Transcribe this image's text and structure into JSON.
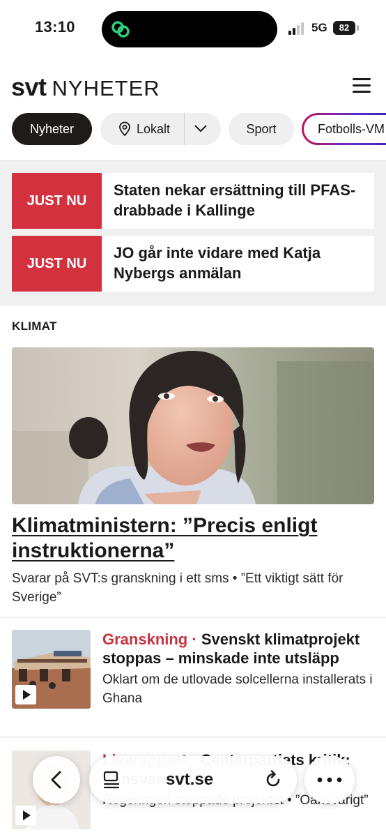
{
  "status_bar": {
    "time": "13:10",
    "network": "5G",
    "battery": "82"
  },
  "header": {
    "logo_brand": "svt",
    "logo_section": "NYHETER"
  },
  "nav": {
    "tabs": [
      {
        "label": "Nyheter",
        "active": true
      },
      {
        "label": "Lokalt"
      },
      {
        "label": "Sport"
      },
      {
        "label": "Fotbolls-VM"
      }
    ]
  },
  "just_nu": [
    {
      "badge": "JUST NU",
      "headline": "Staten nekar ersättning till PFAS-drabbade i Kallinge"
    },
    {
      "badge": "JUST NU",
      "headline": "JO går inte vidare med Katja Nybergs anmälan"
    }
  ],
  "section": {
    "label": "KLIMAT",
    "hero": {
      "title": "Klimatministern: ”Precis enligt instruktionerna”",
      "subtitle": "Svarar på SVT:s granskning i ett sms • ”Ett viktigt sätt för Sverige”"
    }
  },
  "articles": [
    {
      "kicker": "Granskning",
      "separator": " · ",
      "title": "Svenskt klimatprojekt stoppas – minskade inte utsläpp",
      "subtitle": "Oklart om de utlovade solcellerna installerats i Ghana",
      "video": true
    },
    {
      "kicker": "Liverapport",
      "separator": " · ",
      "title": "Centerpartiets kritik: ”Ansvarslöst”",
      "subtitle": "Regeringen stoppade projektet • ”Oansvarigt”",
      "video": true
    }
  ],
  "browser": {
    "url": "svt.se"
  },
  "colors": {
    "accent_red": "#d2313d",
    "kicker_red": "#c8323c",
    "active_tab": "#1e1b18"
  }
}
